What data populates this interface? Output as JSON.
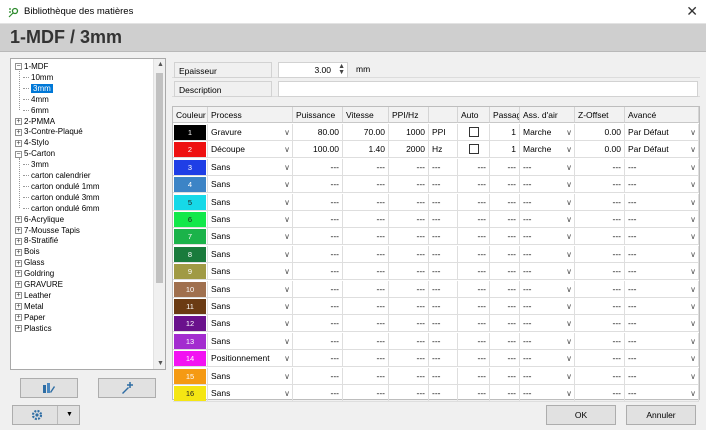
{
  "window": {
    "title": "Bibliothèque des matières",
    "close_glyph": "✕"
  },
  "header": {
    "title": "1-MDF / 3mm"
  },
  "tree": {
    "items": [
      {
        "label": "1-MDF",
        "level": 0,
        "expander": "−"
      },
      {
        "label": "10mm",
        "level": 1
      },
      {
        "label": "3mm",
        "level": 1,
        "selected": true
      },
      {
        "label": "4mm",
        "level": 1
      },
      {
        "label": "6mm",
        "level": 1
      },
      {
        "label": "2-PMMA",
        "level": 0,
        "expander": "+"
      },
      {
        "label": "3-Contre-Plaqué",
        "level": 0,
        "expander": "+"
      },
      {
        "label": "4-Stylo",
        "level": 0,
        "expander": "+"
      },
      {
        "label": "5-Carton",
        "level": 0,
        "expander": "−"
      },
      {
        "label": "3mm",
        "level": 1
      },
      {
        "label": "carton calendrier",
        "level": 1
      },
      {
        "label": "carton ondulé 1mm",
        "level": 1
      },
      {
        "label": "carton ondulé 3mm",
        "level": 1
      },
      {
        "label": "carton ondulé 6mm",
        "level": 1
      },
      {
        "label": "6-Acrylique",
        "level": 0,
        "expander": "+"
      },
      {
        "label": "7-Mousse Tapis",
        "level": 0,
        "expander": "+"
      },
      {
        "label": "8-Stratifié",
        "level": 0,
        "expander": "+"
      },
      {
        "label": "Bois",
        "level": 0,
        "expander": "+"
      },
      {
        "label": "Glass",
        "level": 0,
        "expander": "+"
      },
      {
        "label": "Goldring",
        "level": 0,
        "expander": "+"
      },
      {
        "label": "GRAVURE",
        "level": 0,
        "expander": "+"
      },
      {
        "label": "Leather",
        "level": 0,
        "expander": "+"
      },
      {
        "label": "Metal",
        "level": 0,
        "expander": "+"
      },
      {
        "label": "Paper",
        "level": 0,
        "expander": "+"
      },
      {
        "label": "Plastics",
        "level": 0,
        "expander": "+"
      }
    ]
  },
  "side_buttons": [
    {
      "icon": "library-edit-icon"
    },
    {
      "icon": "library-add-icon"
    }
  ],
  "props": {
    "thickness_label": "Epaisseur",
    "thickness_value": "3.00",
    "thickness_unit": "mm",
    "description_label": "Description",
    "description_value": ""
  },
  "grid": {
    "headers": [
      "Couleur",
      "Process",
      "Puissance",
      "Vitesse",
      "PPI/Hz",
      "",
      "Auto",
      "Passage",
      "Ass. d'air",
      "Z-Offset",
      "Avancé"
    ],
    "rows": [
      {
        "num": "1",
        "color": "#000000",
        "process": "Gravure",
        "power": "80.00",
        "speed": "70.00",
        "freq": "1000",
        "unit": "PPI",
        "passes": "1",
        "air": "Marche",
        "zoffset": "0.00",
        "adv": "Par Défaut"
      },
      {
        "num": "2",
        "color": "#ee1111",
        "process": "Découpe",
        "power": "100.00",
        "speed": "1.40",
        "freq": "2000",
        "unit": "Hz",
        "passes": "1",
        "air": "Marche",
        "zoffset": "0.00",
        "adv": "Par Défaut"
      },
      {
        "num": "3",
        "color": "#1f3ee6",
        "process": "Sans",
        "power": "---",
        "speed": "---",
        "freq": "---",
        "unit": "---",
        "passes": "---",
        "air": "---",
        "zoffset": "---",
        "adv": "---"
      },
      {
        "num": "4",
        "color": "#3c84c6",
        "process": "Sans",
        "power": "---",
        "speed": "---",
        "freq": "---",
        "unit": "---",
        "passes": "---",
        "air": "---",
        "zoffset": "---",
        "adv": "---"
      },
      {
        "num": "5",
        "color": "#16d9e8",
        "process": "Sans",
        "power": "---",
        "speed": "---",
        "freq": "---",
        "unit": "---",
        "passes": "---",
        "air": "---",
        "zoffset": "---",
        "adv": "---"
      },
      {
        "num": "6",
        "color": "#12e84a",
        "process": "Sans",
        "power": "---",
        "speed": "---",
        "freq": "---",
        "unit": "---",
        "passes": "---",
        "air": "---",
        "zoffset": "---",
        "adv": "---"
      },
      {
        "num": "7",
        "color": "#1bb34a",
        "process": "Sans",
        "power": "---",
        "speed": "---",
        "freq": "---",
        "unit": "---",
        "passes": "---",
        "air": "---",
        "zoffset": "---",
        "adv": "---"
      },
      {
        "num": "8",
        "color": "#1a7b3c",
        "process": "Sans",
        "power": "---",
        "speed": "---",
        "freq": "---",
        "unit": "---",
        "passes": "---",
        "air": "---",
        "zoffset": "---",
        "adv": "---"
      },
      {
        "num": "9",
        "color": "#a09a44",
        "process": "Sans",
        "power": "---",
        "speed": "---",
        "freq": "---",
        "unit": "---",
        "passes": "---",
        "air": "---",
        "zoffset": "---",
        "adv": "---"
      },
      {
        "num": "10",
        "color": "#a0704e",
        "process": "Sans",
        "power": "---",
        "speed": "---",
        "freq": "---",
        "unit": "---",
        "passes": "---",
        "air": "---",
        "zoffset": "---",
        "adv": "---"
      },
      {
        "num": "11",
        "color": "#6b3b13",
        "process": "Sans",
        "power": "---",
        "speed": "---",
        "freq": "---",
        "unit": "---",
        "passes": "---",
        "air": "---",
        "zoffset": "---",
        "adv": "---"
      },
      {
        "num": "12",
        "color": "#6a118c",
        "process": "Sans",
        "power": "---",
        "speed": "---",
        "freq": "---",
        "unit": "---",
        "passes": "---",
        "air": "---",
        "zoffset": "---",
        "adv": "---"
      },
      {
        "num": "13",
        "color": "#a32ccf",
        "process": "Sans",
        "power": "---",
        "speed": "---",
        "freq": "---",
        "unit": "---",
        "passes": "---",
        "air": "---",
        "zoffset": "---",
        "adv": "---"
      },
      {
        "num": "14",
        "color": "#f212f2",
        "process": "Positionnement",
        "power": "---",
        "speed": "---",
        "freq": "---",
        "unit": "---",
        "passes": "---",
        "air": "---",
        "zoffset": "---",
        "adv": "---"
      },
      {
        "num": "15",
        "color": "#f59a13",
        "process": "Sans",
        "power": "---",
        "speed": "---",
        "freq": "---",
        "unit": "---",
        "passes": "---",
        "air": "---",
        "zoffset": "---",
        "adv": "---"
      },
      {
        "num": "16",
        "color": "#f5e613",
        "process": "Sans",
        "power": "---",
        "speed": "---",
        "freq": "---",
        "unit": "---",
        "passes": "---",
        "air": "---",
        "zoffset": "---",
        "adv": "---"
      }
    ]
  },
  "footer": {
    "ok_label": "OK",
    "cancel_label": "Annuler",
    "settings_icon": "gear-icon",
    "dropdown_icon": "chevron-down-icon"
  },
  "colors": {
    "accent": "#0078d7",
    "header_bg": "#cfcfcf",
    "window_bg": "#f0f0f0"
  }
}
